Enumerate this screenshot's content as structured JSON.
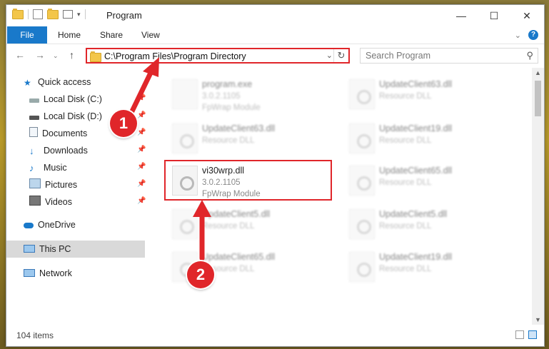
{
  "window": {
    "title": "Program"
  },
  "ribbon": {
    "tabs": [
      "File",
      "Home",
      "Share",
      "View"
    ]
  },
  "address": {
    "path": "C:\\Program Files\\Program Directory"
  },
  "search": {
    "placeholder": "Search Program"
  },
  "sidebar": {
    "items": [
      {
        "label": "Quick access",
        "icon": "star-icon",
        "pinned": false
      },
      {
        "label": "Local Disk (C:)",
        "icon": "drive-icon",
        "pinned": true
      },
      {
        "label": "Local Disk (D:)",
        "icon": "drive-icon",
        "pinned": true
      },
      {
        "label": "Documents",
        "icon": "documents-icon",
        "pinned": true
      },
      {
        "label": "Downloads",
        "icon": "download-arrow-icon",
        "pinned": true
      },
      {
        "label": "Music",
        "icon": "music-note-icon",
        "pinned": true
      },
      {
        "label": "Pictures",
        "icon": "pictures-icon",
        "pinned": true
      },
      {
        "label": "Videos",
        "icon": "videos-icon",
        "pinned": true
      },
      {
        "label": "OneDrive",
        "icon": "cloud-icon",
        "pinned": false
      },
      {
        "label": "This PC",
        "icon": "computer-icon",
        "pinned": false
      },
      {
        "label": "Network",
        "icon": "network-icon",
        "pinned": false
      }
    ],
    "selected": "This PC"
  },
  "files": {
    "left": [
      {
        "name": "program.exe",
        "version": "3.0.2.1105",
        "desc": "FpWrap Module"
      },
      {
        "name": "UpdateClient63.dll",
        "version": "Resource DLL",
        "desc": ""
      },
      {
        "name": "vi30wrp.dll",
        "version": "3.0.2.1105",
        "desc": "FpWrap Module"
      },
      {
        "name": "UpdateClient5.dll",
        "version": "Resource DLL",
        "desc": ""
      },
      {
        "name": "UpdateClient65.dll",
        "version": "Resource DLL",
        "desc": ""
      }
    ],
    "right": [
      {
        "name": "UpdateClient63.dll",
        "version": "Resource DLL"
      },
      {
        "name": "UpdateClient19.dll",
        "version": "Resource DLL"
      },
      {
        "name": "UpdateClient65.dll",
        "version": "Resource DLL"
      },
      {
        "name": "UpdateClient5.dll",
        "version": "Resource DLL"
      },
      {
        "name": "UpdateClient19.dll",
        "version": "Resource DLL"
      }
    ]
  },
  "status": {
    "count": "104 items"
  },
  "callouts": [
    "1",
    "2"
  ],
  "colors": {
    "accent": "#1979ca",
    "highlight": "#e0262a"
  }
}
